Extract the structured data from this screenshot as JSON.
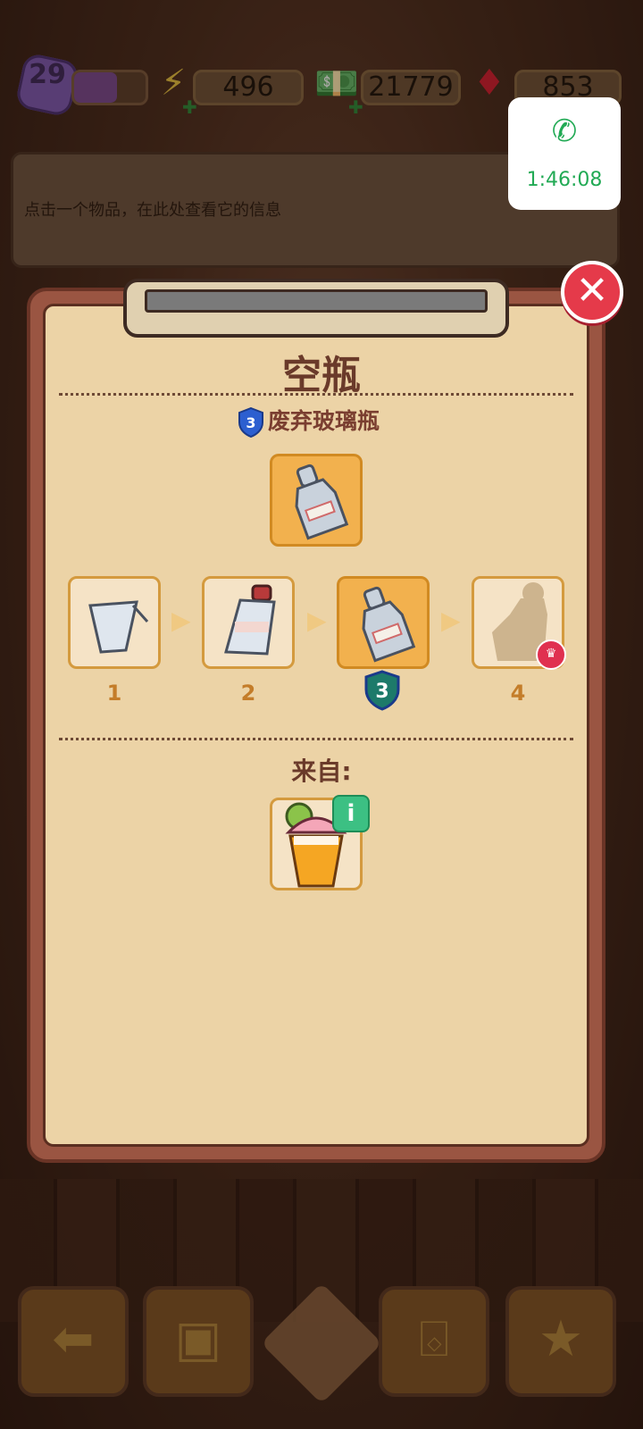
{
  "hud": {
    "level": "29",
    "level_progress": 0.6,
    "energy": "496",
    "cash": "21779",
    "gems": "853"
  },
  "info_box": {
    "hint": "点击一个物品，在此处查看它的信息"
  },
  "call_widget": {
    "time": "1:46:08"
  },
  "modal": {
    "title": "空瓶",
    "subtitle": "废弃玻璃瓶",
    "subtitle_level": "3",
    "chain_levels": [
      "1",
      "2",
      "3",
      "4"
    ],
    "active_level": "3",
    "from_label": "来自:",
    "info_badge": "i"
  },
  "colors": {
    "accent": "#e53a4a",
    "paper": "#ecd3a6",
    "frame": "#9a5542",
    "tile_active": "#f2b14e"
  },
  "icons": {
    "close": "close-icon",
    "back": "back-arrow-icon",
    "backpack": "backpack-icon",
    "basket": "basket-icon",
    "clipboard": "clipboard-star-icon"
  }
}
